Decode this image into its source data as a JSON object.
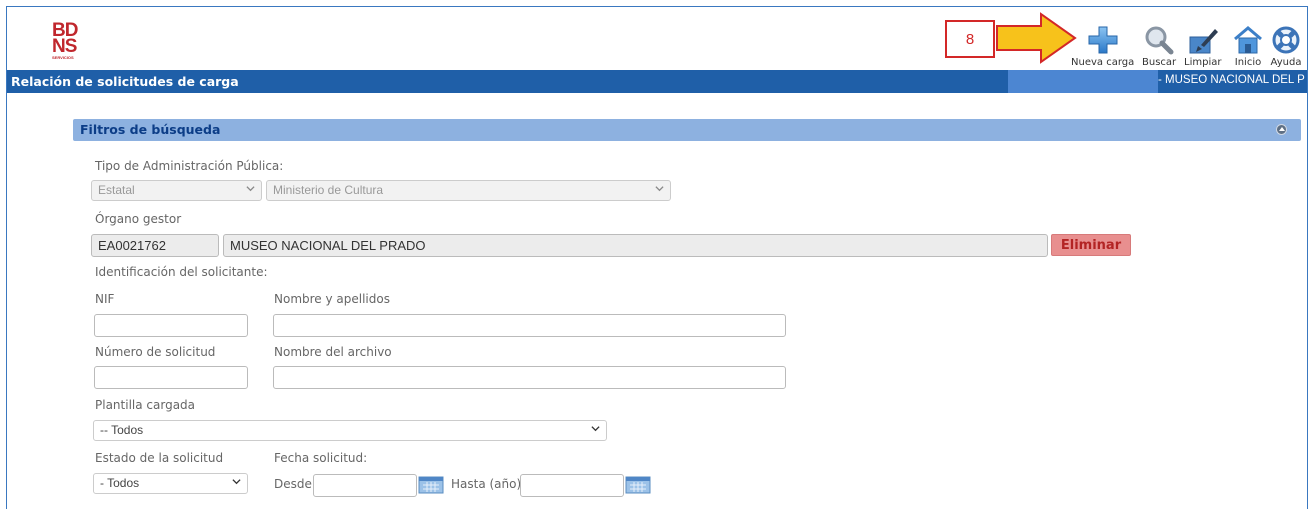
{
  "logo": {
    "line1": "BD",
    "line2": "NS",
    "sub": "SERVICIOS"
  },
  "callout": {
    "number": "8",
    "color": "#d32828"
  },
  "toolbar": {
    "items": [
      {
        "label": "Nueva carga",
        "icon": "plus-icon"
      },
      {
        "label": "Buscar",
        "icon": "magnifier-icon"
      },
      {
        "label": "Limpiar",
        "icon": "brush-icon"
      },
      {
        "label": "Inicio",
        "icon": "home-icon"
      },
      {
        "label": "Ayuda",
        "icon": "lifebuoy-icon"
      }
    ]
  },
  "titlebar": {
    "title": "Relación de solicitudes de carga",
    "organism": "- MUSEO NACIONAL DEL P"
  },
  "filters": {
    "heading": "Filtros de búsqueda",
    "admin_type_label": "Tipo de Administración Pública:",
    "admin_type_value": "Estatal",
    "ministry_value": "Ministerio de Cultura",
    "organ_label": "Órgano gestor",
    "organ_code": "EA0021762",
    "organ_name": "MUSEO NACIONAL DEL PRADO",
    "delete_label": "Eliminar",
    "applicant_label": "Identificación del solicitante:",
    "nif_label": "NIF",
    "nif_value": "",
    "name_label": "Nombre y apellidos",
    "name_value": "",
    "request_no_label": "Número de solicitud",
    "request_no_value": "",
    "file_name_label": "Nombre del archivo",
    "file_name_value": "",
    "template_label": "Plantilla cargada",
    "template_value": "-- Todos",
    "status_label": "Estado de la solicitud",
    "status_value": "- Todos",
    "date_label": "Fecha solicitud:",
    "from_label": "Desde",
    "from_value": "",
    "to_label": "Hasta (año)",
    "to_value": ""
  },
  "colors": {
    "titlebar": "#1f5fa8",
    "panel_header": "#8db1e0",
    "delete_button": "#e88f8f",
    "arrow_fill": "#f7c21b",
    "arrow_stroke": "#d32828"
  }
}
